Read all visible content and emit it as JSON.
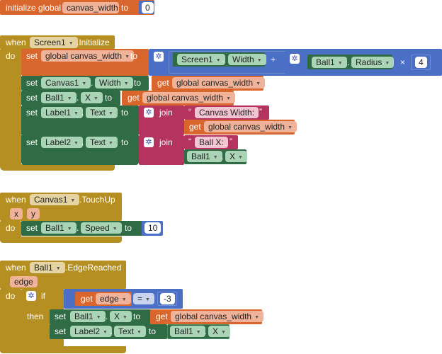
{
  "blocks": {
    "init": {
      "prefix": "initialize global",
      "var": "canvas_width",
      "to": "to",
      "value": "0"
    },
    "screen_init": {
      "when": "when",
      "component": "Screen1",
      "event": ".Initialize",
      "do": "do",
      "row1": {
        "set": "set",
        "target": "global canvas_width",
        "to": "to",
        "comp1": "Screen1",
        "dot1": ".",
        "prop1": "Width",
        "plus": "+",
        "comp2": "Ball1",
        "dot2": ".",
        "prop2": "Radius",
        "times": "×",
        "factor": "4"
      },
      "row2": {
        "set": "set",
        "comp": "Canvas1",
        "dot": ".",
        "prop": "Width",
        "to": "to",
        "get": "get",
        "getvar": "global canvas_width"
      },
      "row3": {
        "set": "set",
        "comp": "Ball1",
        "dot": ".",
        "prop": "X",
        "to": "to",
        "get": "get",
        "getvar": "global canvas_width"
      },
      "row4": {
        "set": "set",
        "comp": "Label1",
        "dot": ".",
        "prop": "Text",
        "to": "to",
        "join": "join",
        "str": "Canvas Width:",
        "get": "get",
        "getvar": "global canvas_width"
      },
      "row5": {
        "set": "set",
        "comp": "Label2",
        "dot": ".",
        "prop": "Text",
        "to": "to",
        "join": "join",
        "str": "Ball X:",
        "comp2": "Ball1",
        "dot2": ".",
        "prop2": "X"
      }
    },
    "touchup": {
      "when": "when",
      "component": "Canvas1",
      "event": ".TouchUp",
      "param_x": "x",
      "param_y": "y",
      "do": "do",
      "set": "set",
      "comp": "Ball1",
      "dot": ".",
      "prop": "Speed",
      "to": "to",
      "value": "10"
    },
    "edge": {
      "when": "when",
      "component": "Ball1",
      "event": ".EdgeReached",
      "param": "edge",
      "do": "do",
      "if": "if",
      "get": "get",
      "getvar": "edge",
      "op": "=",
      "value": "-3",
      "then": "then",
      "row1": {
        "set": "set",
        "comp": "Ball1",
        "dot": ".",
        "prop": "X",
        "to": "to",
        "get": "get",
        "getvar": "global canvas_width"
      },
      "row2": {
        "set": "set",
        "comp": "Label2",
        "dot": ".",
        "prop": "Text",
        "to": "to",
        "comp2": "Ball1",
        "dot2": ".",
        "prop2": "X"
      }
    }
  },
  "quote": "“",
  "quote_close": "”",
  "arrow": "▼",
  "gear": "✲",
  "colors": {
    "variable": "#d9672d",
    "event": "#b58f22",
    "component": "#2f6b45",
    "math": "#4a6fc4",
    "text": "#b5345f"
  }
}
